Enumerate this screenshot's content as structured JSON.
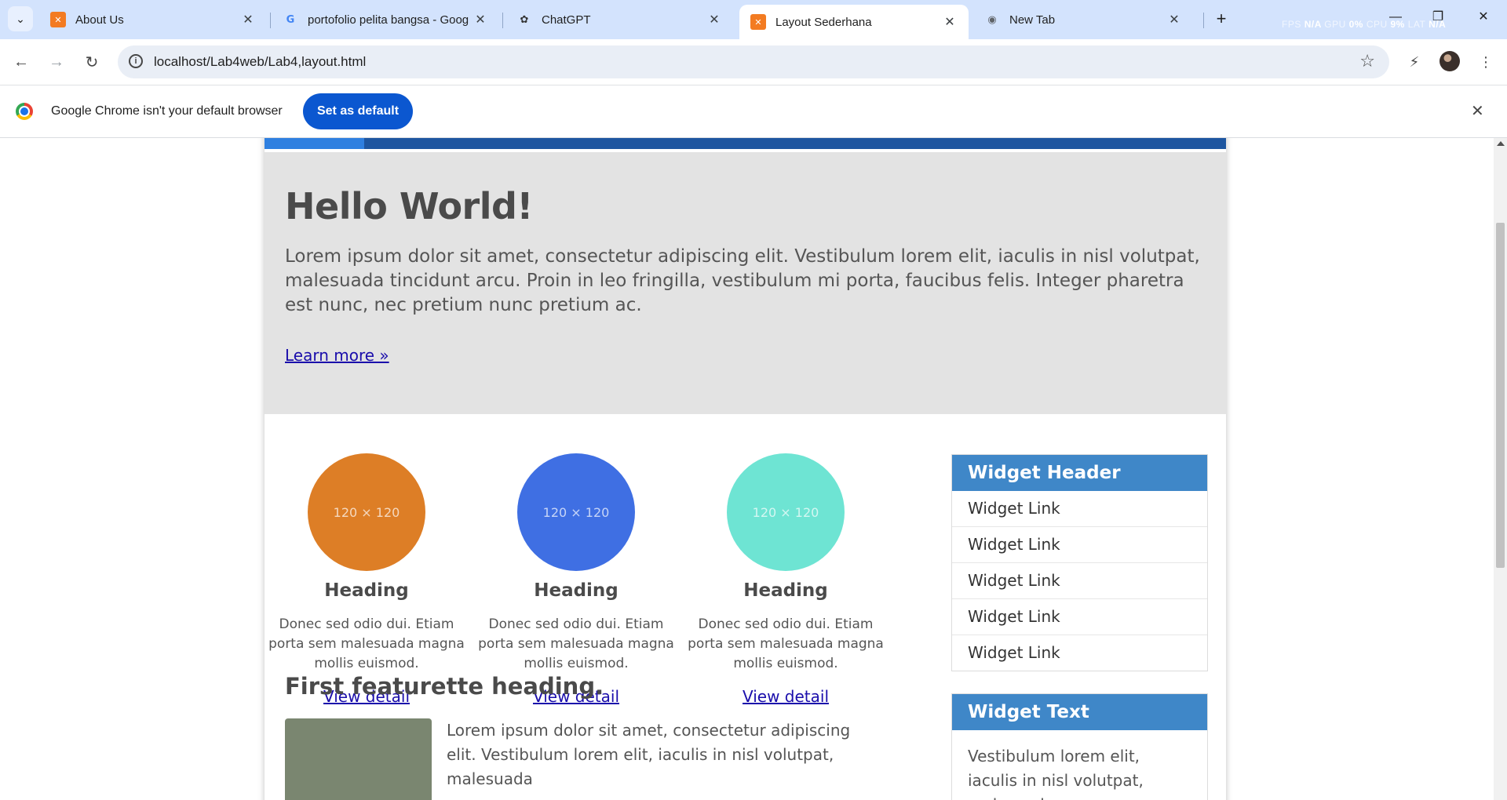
{
  "browser": {
    "tabs": [
      {
        "title": "About Us",
        "icon": "xampp-icon",
        "active": false
      },
      {
        "title": "portofolio pelita bangsa - Goog",
        "icon": "google-icon",
        "active": false
      },
      {
        "title": "ChatGPT",
        "icon": "chatgpt-icon",
        "active": false
      },
      {
        "title": "Layout Sederhana",
        "icon": "xampp-icon",
        "active": true
      },
      {
        "title": "New Tab",
        "icon": "chrome-icon",
        "active": false
      }
    ],
    "perf": {
      "fps_label": "FPS",
      "fps": "N/A",
      "gpu_label": "GPU",
      "gpu": "0%",
      "cpu_label": "CPU",
      "cpu": "9%",
      "lat_label": "LAT",
      "lat": "N/A"
    },
    "url": "localhost/Lab4web/Lab4,layout.html",
    "infobar": {
      "message": "Google Chrome isn't your default browser",
      "button": "Set as default"
    }
  },
  "page": {
    "jumbotron": {
      "title": "Hello World!",
      "text": "Lorem ipsum dolor sit amet, consectetur adipiscing elit. Vestibulum lorem elit, iaculis in nisl volutpat, malesuada tincidunt arcu. Proin in leo fringilla, vestibulum mi porta, faucibus felis. Integer pharetra est nunc, nec pretium nunc pretium ac.",
      "link": "Learn more »"
    },
    "columns": [
      {
        "placeholder": "120 × 120",
        "heading": "Heading",
        "text": "Donec sed odio dui. Etiam porta sem malesuada magna mollis euismod.",
        "link": "View detail",
        "color": "#dd7e26"
      },
      {
        "placeholder": "120 × 120",
        "heading": "Heading",
        "text": "Donec sed odio dui. Etiam porta sem malesuada magna mollis euismod.",
        "link": "View detail",
        "color": "#3f6fe3"
      },
      {
        "placeholder": "120 × 120",
        "heading": "Heading",
        "text": "Donec sed odio dui. Etiam porta sem malesuada magna mollis euismod.",
        "link": "View detail",
        "color": "#6ee4d3"
      }
    ],
    "featurette": {
      "heading": "First featurette heading.",
      "text": "Lorem ipsum dolor sit amet, consectetur adipiscing elit. Vestibulum lorem elit, iaculis in nisl volutpat, malesuada"
    },
    "widget_links": {
      "header": "Widget Header",
      "links": [
        "Widget Link",
        "Widget Link",
        "Widget Link",
        "Widget Link",
        "Widget Link"
      ]
    },
    "widget_text": {
      "header": "Widget Text",
      "text": "Vestibulum lorem elit, iaculis in nisl volutpat, malesuada"
    }
  }
}
